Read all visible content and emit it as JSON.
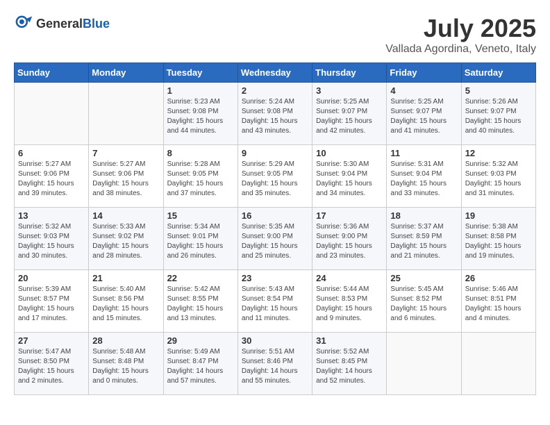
{
  "header": {
    "logo_general": "General",
    "logo_blue": "Blue",
    "month_title": "July 2025",
    "location": "Vallada Agordina, Veneto, Italy"
  },
  "weekdays": [
    "Sunday",
    "Monday",
    "Tuesday",
    "Wednesday",
    "Thursday",
    "Friday",
    "Saturday"
  ],
  "weeks": [
    [
      {
        "day": "",
        "sunrise": "",
        "sunset": "",
        "daylight": ""
      },
      {
        "day": "",
        "sunrise": "",
        "sunset": "",
        "daylight": ""
      },
      {
        "day": "1",
        "sunrise": "Sunrise: 5:23 AM",
        "sunset": "Sunset: 9:08 PM",
        "daylight": "Daylight: 15 hours and 44 minutes."
      },
      {
        "day": "2",
        "sunrise": "Sunrise: 5:24 AM",
        "sunset": "Sunset: 9:08 PM",
        "daylight": "Daylight: 15 hours and 43 minutes."
      },
      {
        "day": "3",
        "sunrise": "Sunrise: 5:25 AM",
        "sunset": "Sunset: 9:07 PM",
        "daylight": "Daylight: 15 hours and 42 minutes."
      },
      {
        "day": "4",
        "sunrise": "Sunrise: 5:25 AM",
        "sunset": "Sunset: 9:07 PM",
        "daylight": "Daylight: 15 hours and 41 minutes."
      },
      {
        "day": "5",
        "sunrise": "Sunrise: 5:26 AM",
        "sunset": "Sunset: 9:07 PM",
        "daylight": "Daylight: 15 hours and 40 minutes."
      }
    ],
    [
      {
        "day": "6",
        "sunrise": "Sunrise: 5:27 AM",
        "sunset": "Sunset: 9:06 PM",
        "daylight": "Daylight: 15 hours and 39 minutes."
      },
      {
        "day": "7",
        "sunrise": "Sunrise: 5:27 AM",
        "sunset": "Sunset: 9:06 PM",
        "daylight": "Daylight: 15 hours and 38 minutes."
      },
      {
        "day": "8",
        "sunrise": "Sunrise: 5:28 AM",
        "sunset": "Sunset: 9:05 PM",
        "daylight": "Daylight: 15 hours and 37 minutes."
      },
      {
        "day": "9",
        "sunrise": "Sunrise: 5:29 AM",
        "sunset": "Sunset: 9:05 PM",
        "daylight": "Daylight: 15 hours and 35 minutes."
      },
      {
        "day": "10",
        "sunrise": "Sunrise: 5:30 AM",
        "sunset": "Sunset: 9:04 PM",
        "daylight": "Daylight: 15 hours and 34 minutes."
      },
      {
        "day": "11",
        "sunrise": "Sunrise: 5:31 AM",
        "sunset": "Sunset: 9:04 PM",
        "daylight": "Daylight: 15 hours and 33 minutes."
      },
      {
        "day": "12",
        "sunrise": "Sunrise: 5:32 AM",
        "sunset": "Sunset: 9:03 PM",
        "daylight": "Daylight: 15 hours and 31 minutes."
      }
    ],
    [
      {
        "day": "13",
        "sunrise": "Sunrise: 5:32 AM",
        "sunset": "Sunset: 9:03 PM",
        "daylight": "Daylight: 15 hours and 30 minutes."
      },
      {
        "day": "14",
        "sunrise": "Sunrise: 5:33 AM",
        "sunset": "Sunset: 9:02 PM",
        "daylight": "Daylight: 15 hours and 28 minutes."
      },
      {
        "day": "15",
        "sunrise": "Sunrise: 5:34 AM",
        "sunset": "Sunset: 9:01 PM",
        "daylight": "Daylight: 15 hours and 26 minutes."
      },
      {
        "day": "16",
        "sunrise": "Sunrise: 5:35 AM",
        "sunset": "Sunset: 9:00 PM",
        "daylight": "Daylight: 15 hours and 25 minutes."
      },
      {
        "day": "17",
        "sunrise": "Sunrise: 5:36 AM",
        "sunset": "Sunset: 9:00 PM",
        "daylight": "Daylight: 15 hours and 23 minutes."
      },
      {
        "day": "18",
        "sunrise": "Sunrise: 5:37 AM",
        "sunset": "Sunset: 8:59 PM",
        "daylight": "Daylight: 15 hours and 21 minutes."
      },
      {
        "day": "19",
        "sunrise": "Sunrise: 5:38 AM",
        "sunset": "Sunset: 8:58 PM",
        "daylight": "Daylight: 15 hours and 19 minutes."
      }
    ],
    [
      {
        "day": "20",
        "sunrise": "Sunrise: 5:39 AM",
        "sunset": "Sunset: 8:57 PM",
        "daylight": "Daylight: 15 hours and 17 minutes."
      },
      {
        "day": "21",
        "sunrise": "Sunrise: 5:40 AM",
        "sunset": "Sunset: 8:56 PM",
        "daylight": "Daylight: 15 hours and 15 minutes."
      },
      {
        "day": "22",
        "sunrise": "Sunrise: 5:42 AM",
        "sunset": "Sunset: 8:55 PM",
        "daylight": "Daylight: 15 hours and 13 minutes."
      },
      {
        "day": "23",
        "sunrise": "Sunrise: 5:43 AM",
        "sunset": "Sunset: 8:54 PM",
        "daylight": "Daylight: 15 hours and 11 minutes."
      },
      {
        "day": "24",
        "sunrise": "Sunrise: 5:44 AM",
        "sunset": "Sunset: 8:53 PM",
        "daylight": "Daylight: 15 hours and 9 minutes."
      },
      {
        "day": "25",
        "sunrise": "Sunrise: 5:45 AM",
        "sunset": "Sunset: 8:52 PM",
        "daylight": "Daylight: 15 hours and 6 minutes."
      },
      {
        "day": "26",
        "sunrise": "Sunrise: 5:46 AM",
        "sunset": "Sunset: 8:51 PM",
        "daylight": "Daylight: 15 hours and 4 minutes."
      }
    ],
    [
      {
        "day": "27",
        "sunrise": "Sunrise: 5:47 AM",
        "sunset": "Sunset: 8:50 PM",
        "daylight": "Daylight: 15 hours and 2 minutes."
      },
      {
        "day": "28",
        "sunrise": "Sunrise: 5:48 AM",
        "sunset": "Sunset: 8:48 PM",
        "daylight": "Daylight: 15 hours and 0 minutes."
      },
      {
        "day": "29",
        "sunrise": "Sunrise: 5:49 AM",
        "sunset": "Sunset: 8:47 PM",
        "daylight": "Daylight: 14 hours and 57 minutes."
      },
      {
        "day": "30",
        "sunrise": "Sunrise: 5:51 AM",
        "sunset": "Sunset: 8:46 PM",
        "daylight": "Daylight: 14 hours and 55 minutes."
      },
      {
        "day": "31",
        "sunrise": "Sunrise: 5:52 AM",
        "sunset": "Sunset: 8:45 PM",
        "daylight": "Daylight: 14 hours and 52 minutes."
      },
      {
        "day": "",
        "sunrise": "",
        "sunset": "",
        "daylight": ""
      },
      {
        "day": "",
        "sunrise": "",
        "sunset": "",
        "daylight": ""
      }
    ]
  ]
}
